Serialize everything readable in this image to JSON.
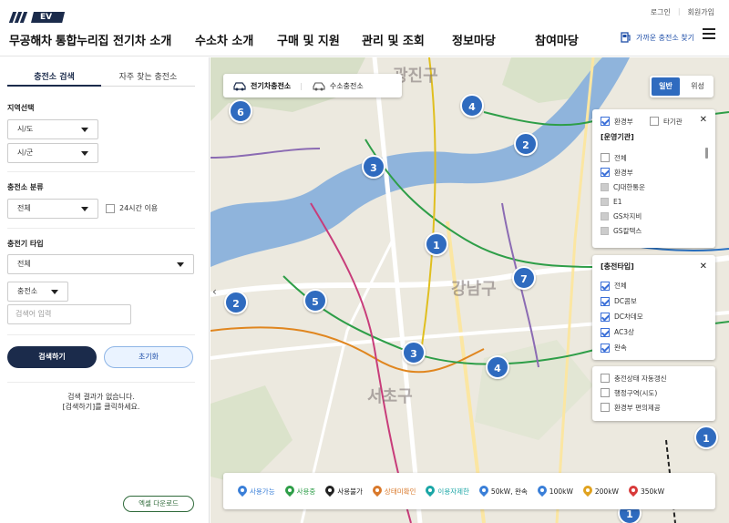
{
  "header": {
    "logo_badge": "EV",
    "site_title": "무공해차 통합누리집",
    "nav": [
      "전기차 소개",
      "수소차 소개",
      "구매 및 지원",
      "관리 및 조회",
      "정보마당",
      "참여마당"
    ],
    "util_login": "로그인",
    "util_join": "회원가입",
    "nearby_label": "가까운 충전소 찾기"
  },
  "panel": {
    "tabs": [
      "충전소 검색",
      "자주 찾는 충전소"
    ],
    "region_label": "지역선택",
    "sido": "시/도",
    "sigun": "시/군",
    "class_label": "충전소 분류",
    "class_value": "전체",
    "open24_label": "24시간 이용",
    "type_label": "충전기 타입",
    "type_value": "전체",
    "search_scope": "충전소",
    "search_placeholder": "검색어 입력",
    "search_button": "검색하기",
    "reset_button": "초기화",
    "empty_line1": "검색 결과가 없습니다.",
    "empty_line2": "[검색하기]를 클릭하세요.",
    "excel_button": "엑셀 다운로드"
  },
  "map": {
    "charger_tabs": [
      "전기차충전소",
      "수소충전소"
    ],
    "view_options": [
      "일반",
      "위성"
    ],
    "area_labels": [
      "광진구",
      "강남구",
      "서초구"
    ],
    "clusters": [
      "6",
      "4",
      "2",
      "3",
      "1",
      "7",
      "2",
      "5",
      "3",
      "4",
      "1",
      "1"
    ],
    "operator_filter": {
      "top_options": [
        "환경부",
        "타기관"
      ],
      "title": "[운영기관]",
      "items": [
        {
          "label": "전체",
          "checked": false
        },
        {
          "label": "환경부",
          "checked": true
        },
        {
          "label": "CJ대한통운",
          "checked": false
        },
        {
          "label": "E1",
          "checked": false
        },
        {
          "label": "GS차지비",
          "checked": false
        },
        {
          "label": "GS칼텍스",
          "checked": false
        }
      ]
    },
    "type_filter": {
      "title": "[충전타입]",
      "items": [
        "전체",
        "DC콤보",
        "DC차데모",
        "AC3상",
        "완속"
      ]
    },
    "extra_options": [
      "충전상태 자동갱신",
      "행정구역(시도)",
      "환경부 편의제공"
    ],
    "legend": [
      {
        "label": "사용가능",
        "color": "#3a7fd8"
      },
      {
        "label": "사용중",
        "color": "#2e9e48"
      },
      {
        "label": "사용불가",
        "color": "#222222"
      },
      {
        "label": "상태미확인",
        "color": "#d9782a"
      },
      {
        "label": "이용자제한",
        "color": "#1aa6a6"
      },
      {
        "label": "50kW, 완속",
        "color": "#3a7fd8"
      },
      {
        "label": "100kW",
        "color": "#3a7fd8"
      },
      {
        "label": "200kW",
        "color": "#3a7fd8"
      },
      {
        "label": "350kW",
        "color": "#3a7fd8"
      }
    ]
  },
  "colors": {
    "navy": "#1b2b4b",
    "accent": "#2f6bbf",
    "river": "#8fb4dc"
  }
}
